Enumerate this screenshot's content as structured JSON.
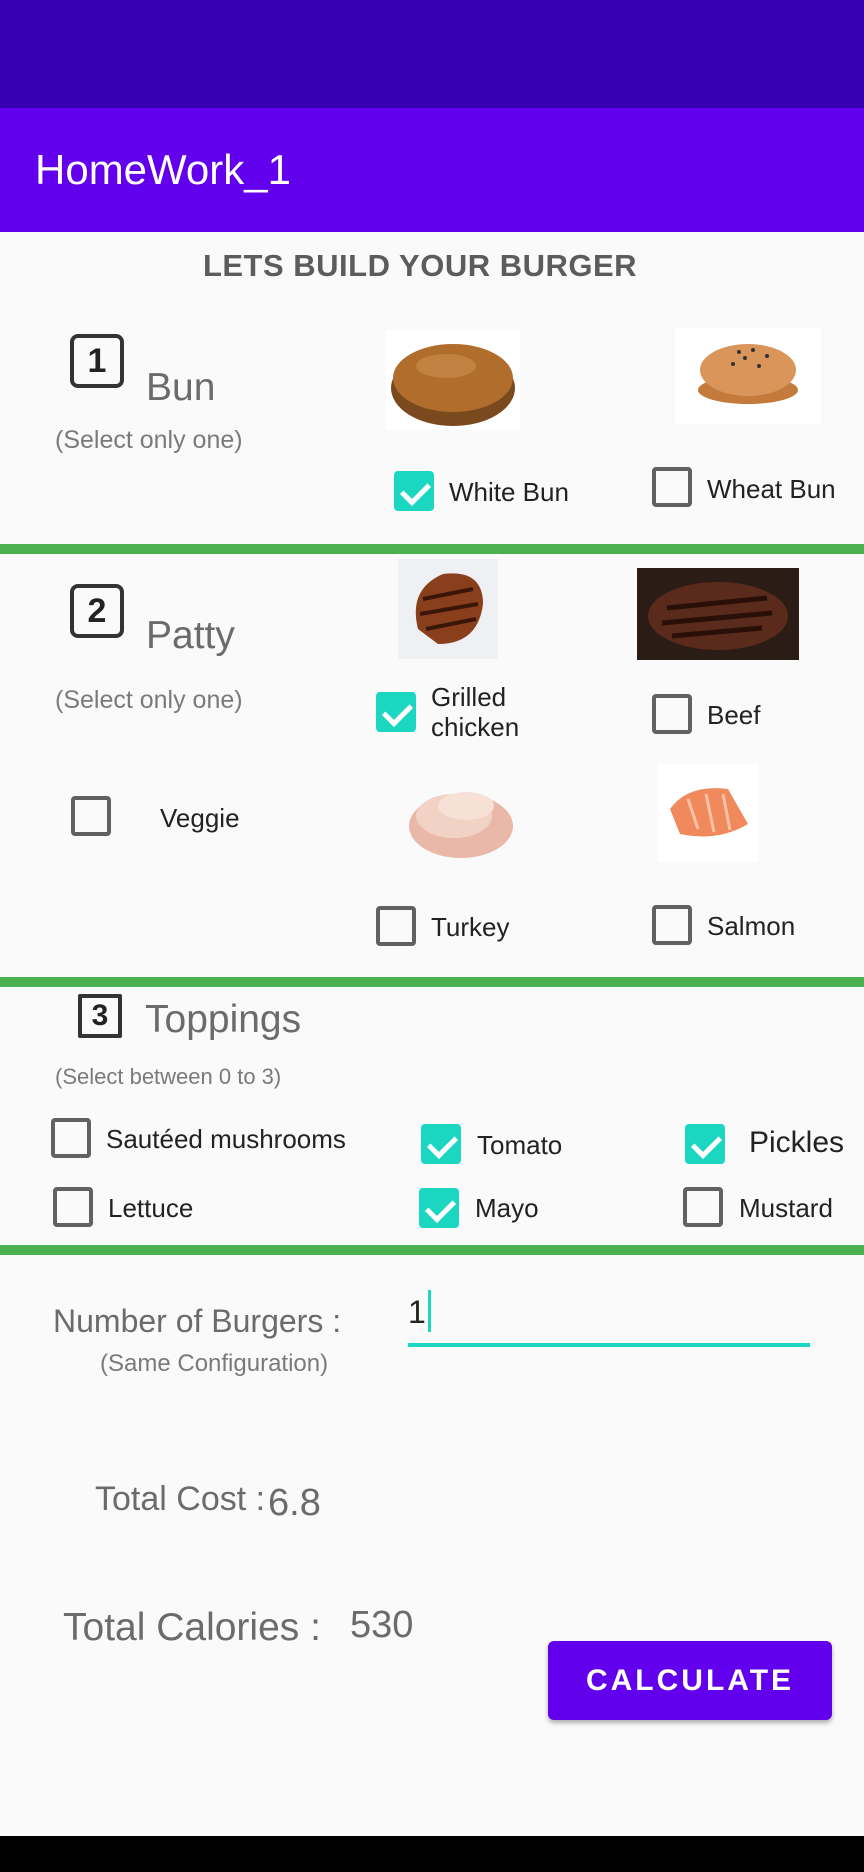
{
  "app": {
    "title": "HomeWork_1",
    "heading": "LETS BUILD YOUR BURGER"
  },
  "bun": {
    "number": "1",
    "title": "Bun",
    "subtitle": "(Select only one)",
    "options": [
      {
        "label": "White Bun",
        "checked": true,
        "icon": "white-bun-image"
      },
      {
        "label": "Wheat Bun",
        "checked": false,
        "icon": "wheat-bun-image"
      }
    ]
  },
  "patty": {
    "number": "2",
    "title": "Patty",
    "subtitle": "(Select only one)",
    "options": [
      {
        "label": "Grilled\nchicken",
        "checked": true,
        "icon": "grilled-chicken-image"
      },
      {
        "label": "Beef",
        "checked": false,
        "icon": "beef-image"
      },
      {
        "label": "Veggie",
        "checked": false
      },
      {
        "label": "Turkey",
        "checked": false,
        "icon": "turkey-image"
      },
      {
        "label": "Salmon",
        "checked": false,
        "icon": "salmon-image"
      }
    ]
  },
  "toppings": {
    "number": "3",
    "title": "Toppings",
    "subtitle": "(Select between 0 to 3)",
    "options": [
      {
        "label": "Sautéed mushrooms",
        "checked": false
      },
      {
        "label": "Tomato",
        "checked": true
      },
      {
        "label": "Pickles",
        "checked": true
      },
      {
        "label": "Lettuce",
        "checked": false
      },
      {
        "label": "Mayo",
        "checked": true
      },
      {
        "label": "Mustard",
        "checked": false
      }
    ]
  },
  "order": {
    "count_label": "Number of Burgers :",
    "count_sub": "(Same Configuration)",
    "count_value": "1",
    "cost_label": "Total Cost :",
    "cost_value": "6.8",
    "calories_label": "Total Calories :",
    "calories_value": "530",
    "calculate_label": "CALCULATE"
  },
  "colors": {
    "status_bar": "#3700b3",
    "app_bar": "#6200ee",
    "accent": "#1bd6c0",
    "divider": "#4caf50"
  }
}
